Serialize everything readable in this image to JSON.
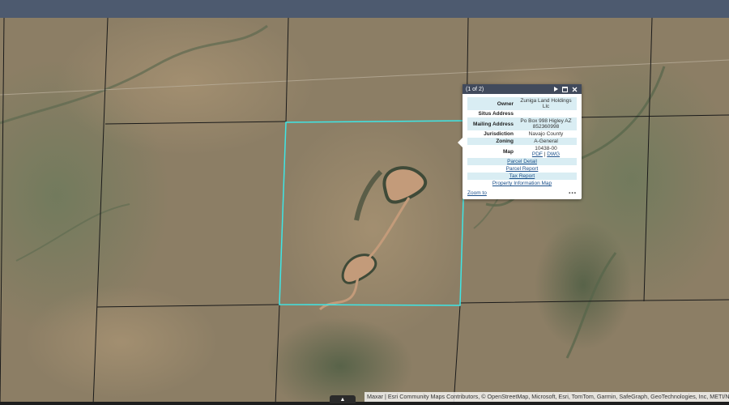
{
  "popup": {
    "count": "(1 of 2)",
    "next_icon": "play-right-icon",
    "maximize_icon": "maximize-icon",
    "close_icon": "close-icon",
    "fields": [
      {
        "key": "Owner",
        "value": "Zuniga Land Holdings Llc"
      },
      {
        "key": "Situs Address",
        "value": ""
      },
      {
        "key": "Mailing Address",
        "value": "Po Box 998 Higley AZ 852360998"
      },
      {
        "key": "Jurisdiction",
        "value": "Navajo County"
      },
      {
        "key": "Zoning",
        "value": "A-General"
      },
      {
        "key": "Map",
        "value": "10438-00"
      }
    ],
    "map_links": {
      "pdf": "PDF",
      "separator": "|",
      "dwg": "DWG"
    },
    "links": [
      "Parcel Detail",
      "Parcel Report",
      "Tax Report",
      "Property Information Map"
    ],
    "zoom_label": "Zoom to",
    "more_label": "•••"
  },
  "attribution": "Maxar | Esri Community Maps Contributors, © OpenStreetMap, Microsoft, Esri, TomTom, Garmin, SafeGraph, GeoTechnologies, Inc, METI/NASA",
  "expand_tab_label": "▲",
  "colors": {
    "parcel_outline": "#3ee6e6",
    "section_lines": "#1a1a1a",
    "header": "#414a5c",
    "shaded_row": "#d9edf3"
  }
}
